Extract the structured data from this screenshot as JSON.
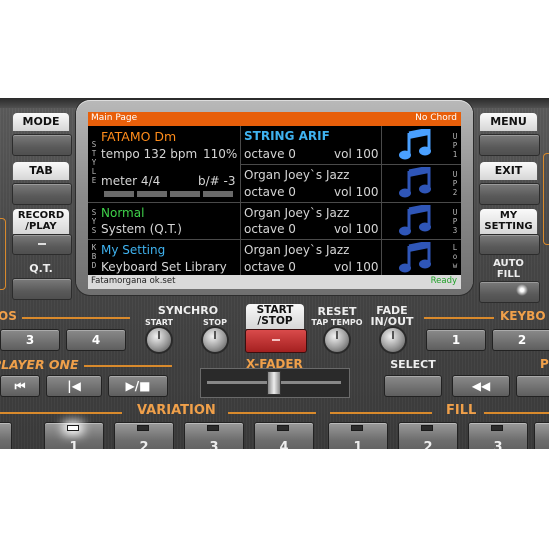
{
  "left_buttons": [
    {
      "label": "MODE"
    },
    {
      "label": "TAB"
    },
    {
      "label": "RECORD\n/PLAY"
    },
    {
      "label": "Q.T."
    }
  ],
  "right_buttons": [
    {
      "label": "MENU"
    },
    {
      "label": "EXIT"
    },
    {
      "label": "MY\nSETTING"
    },
    {
      "label": "AUTO\nFILL"
    }
  ],
  "lcd": {
    "title": "Main Page",
    "status": "No Chord",
    "side_labels": {
      "style": "STYLE",
      "sys": "SYS",
      "kbd": "KBD",
      "up1": "UP1",
      "up2": "UP2",
      "up3": "UP3",
      "low": "Low"
    },
    "style_name": "FATAMO Dm",
    "tempo": "tempo 132 bpm",
    "tempo_pct": "110%",
    "meter": "meter 4/4",
    "transpose": "b/# -3",
    "system_name": "Normal",
    "system_sub": "System (Q.T.)",
    "setting_name": "My Setting",
    "setting_sub": "Keyboard Set Library",
    "sounds": [
      {
        "name": "STRING  ARIF",
        "octave": "octave 0",
        "vol": "vol 100",
        "icon": "music-note-icon"
      },
      {
        "name": "Organ Joey`s Jazz",
        "octave": "octave 0",
        "vol": "vol 100",
        "icon": "music-note-icon"
      },
      {
        "name": "Organ Joey`s Jazz",
        "octave": "octave 0",
        "vol": "vol 100",
        "icon": "music-note-icon"
      },
      {
        "name": "Organ Joey`s Jazz",
        "octave": "octave 0",
        "vol": "vol 100",
        "icon": "music-note-icon"
      }
    ],
    "file": "Fatamorgana ok.set",
    "ready": "Ready"
  },
  "row1": {
    "dos_label": "OS",
    "btn3": "3",
    "btn4": "4",
    "synchro": "SYNCHRO",
    "start": "START",
    "stop": "STOP",
    "start_stop": "START\n/STOP",
    "reset": "RESET",
    "tap_tempo": "TAP TEMPO",
    "fade": "FADE\nIN/OUT",
    "keyb": "KEYBO",
    "k1": "1",
    "k2": "2"
  },
  "row2": {
    "player": "PLAYER ONE",
    "xfader": "X-FADER",
    "select": "SELECT",
    "p": "P"
  },
  "row3": {
    "variation": "VARIATION",
    "fill": "FILL",
    "var_numbers": [
      "1",
      "2",
      "3",
      "4"
    ],
    "fill_numbers": [
      "1",
      "2",
      "3"
    ]
  },
  "colors": {
    "accent": "#e85f0a",
    "cyan": "#3fb3f0",
    "label_orange": "#f0a04a"
  }
}
